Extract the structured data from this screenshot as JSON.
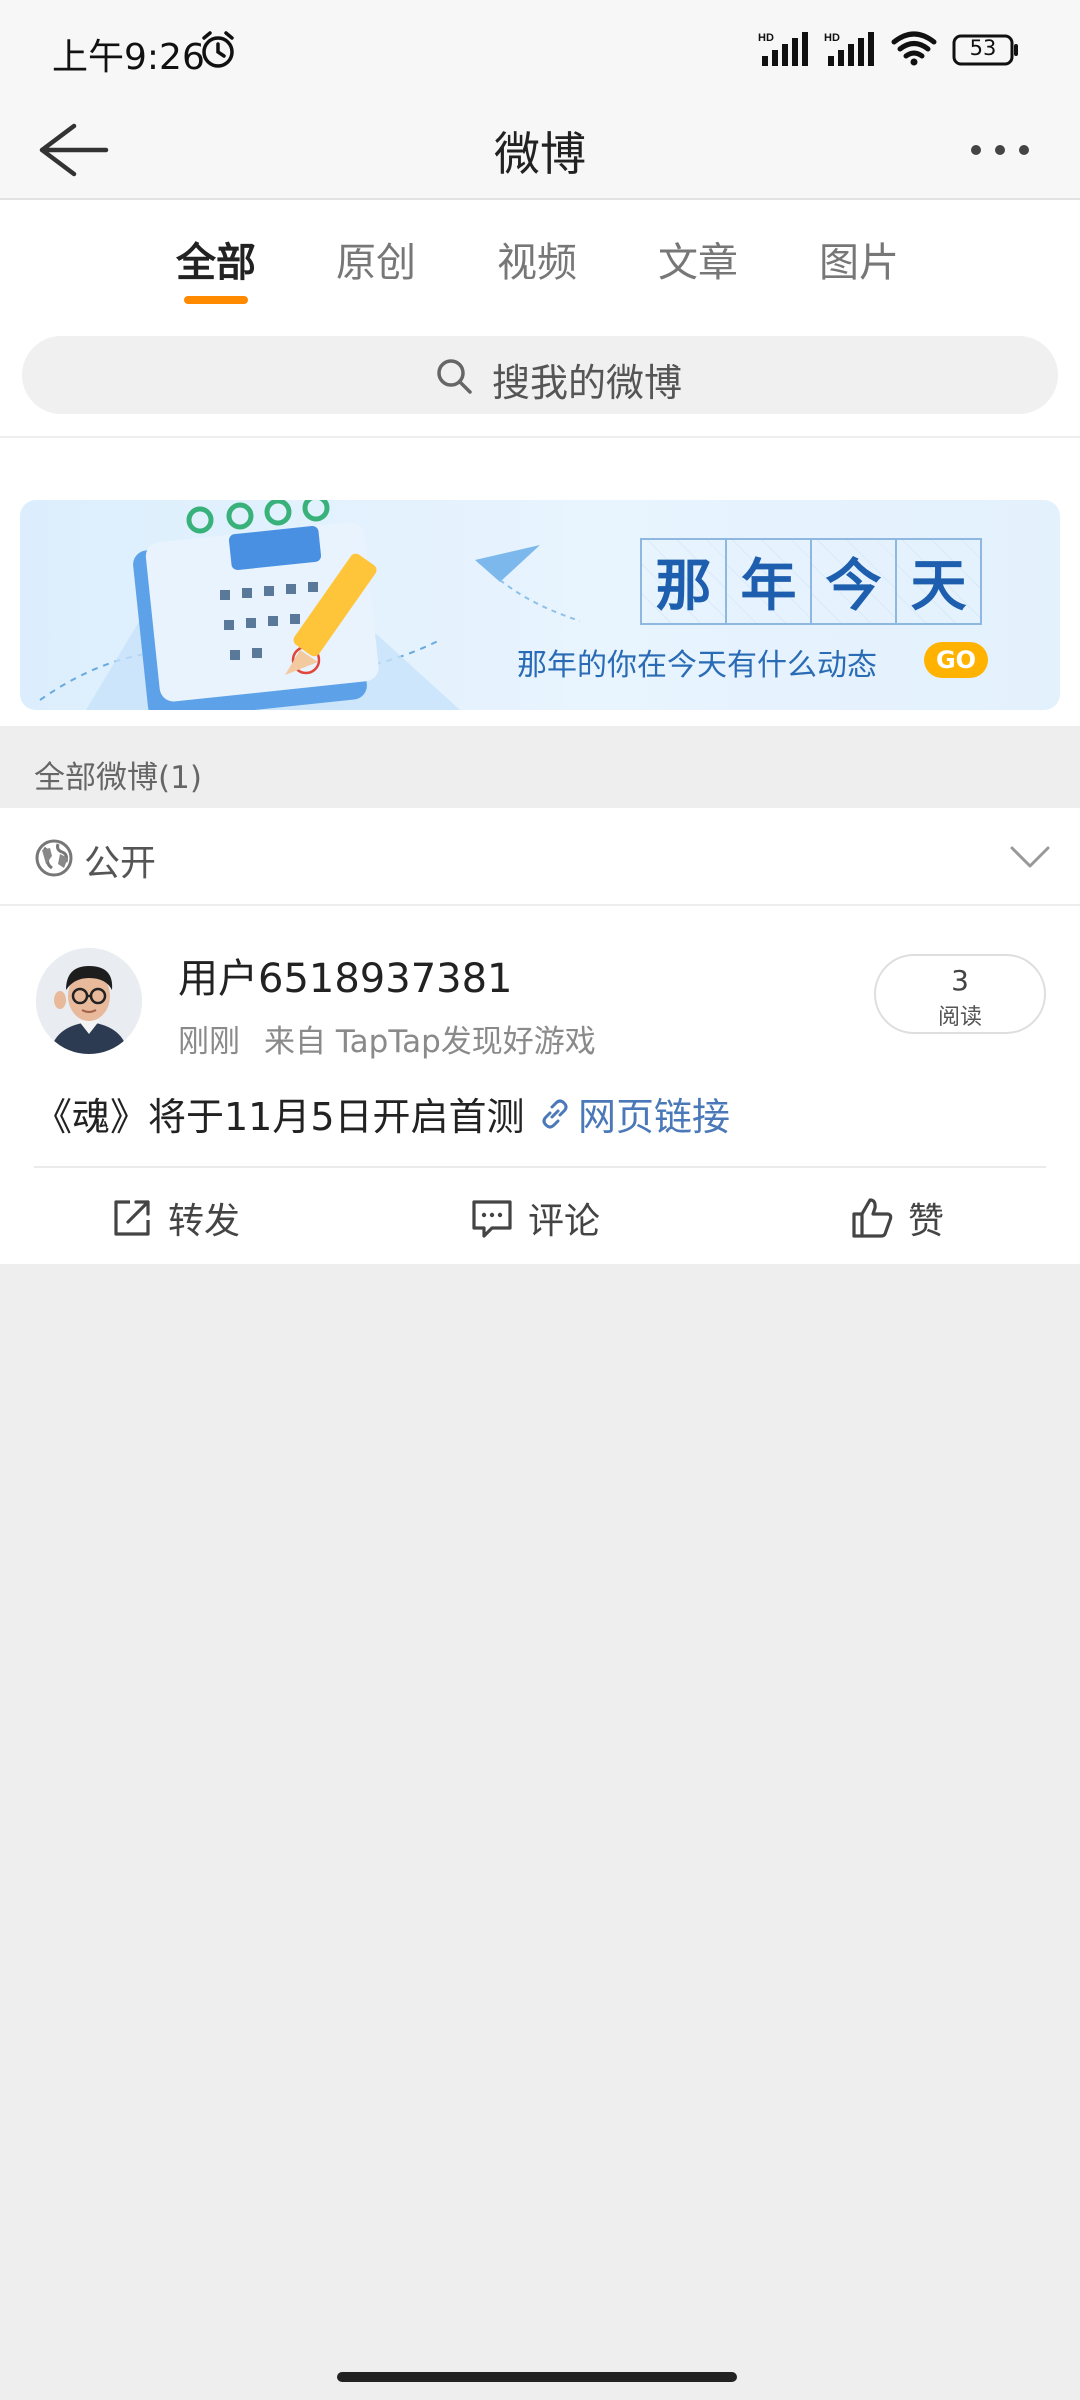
{
  "status_bar": {
    "time": "上午9:26",
    "battery": "53"
  },
  "header": {
    "title": "微博"
  },
  "tabs": [
    {
      "label": "全部",
      "active": true
    },
    {
      "label": "原创",
      "active": false
    },
    {
      "label": "视频",
      "active": false
    },
    {
      "label": "文章",
      "active": false
    },
    {
      "label": "图片",
      "active": false
    }
  ],
  "search": {
    "placeholder": "搜我的微博"
  },
  "banner": {
    "title_chars": [
      "那",
      "年",
      "今",
      "天"
    ],
    "subtitle": "那年的你在今天有什么动态",
    "go_label": "GO"
  },
  "section": {
    "label": "全部微博(1)"
  },
  "filter": {
    "label": "公开"
  },
  "post": {
    "username": "用户6518937381",
    "time": "刚刚",
    "source": "来自 TapTap发现好游戏",
    "read_count": "3",
    "read_label": "阅读",
    "text": "《魂》将于11月5日开启首测",
    "link_label": "网页链接"
  },
  "actions": {
    "repost": "转发",
    "comment": "评论",
    "like": "赞"
  },
  "colors": {
    "accent": "#ff8a00",
    "link": "#4a78b8",
    "banner_text": "#1d5fae",
    "go_badge": "#ffb300"
  }
}
